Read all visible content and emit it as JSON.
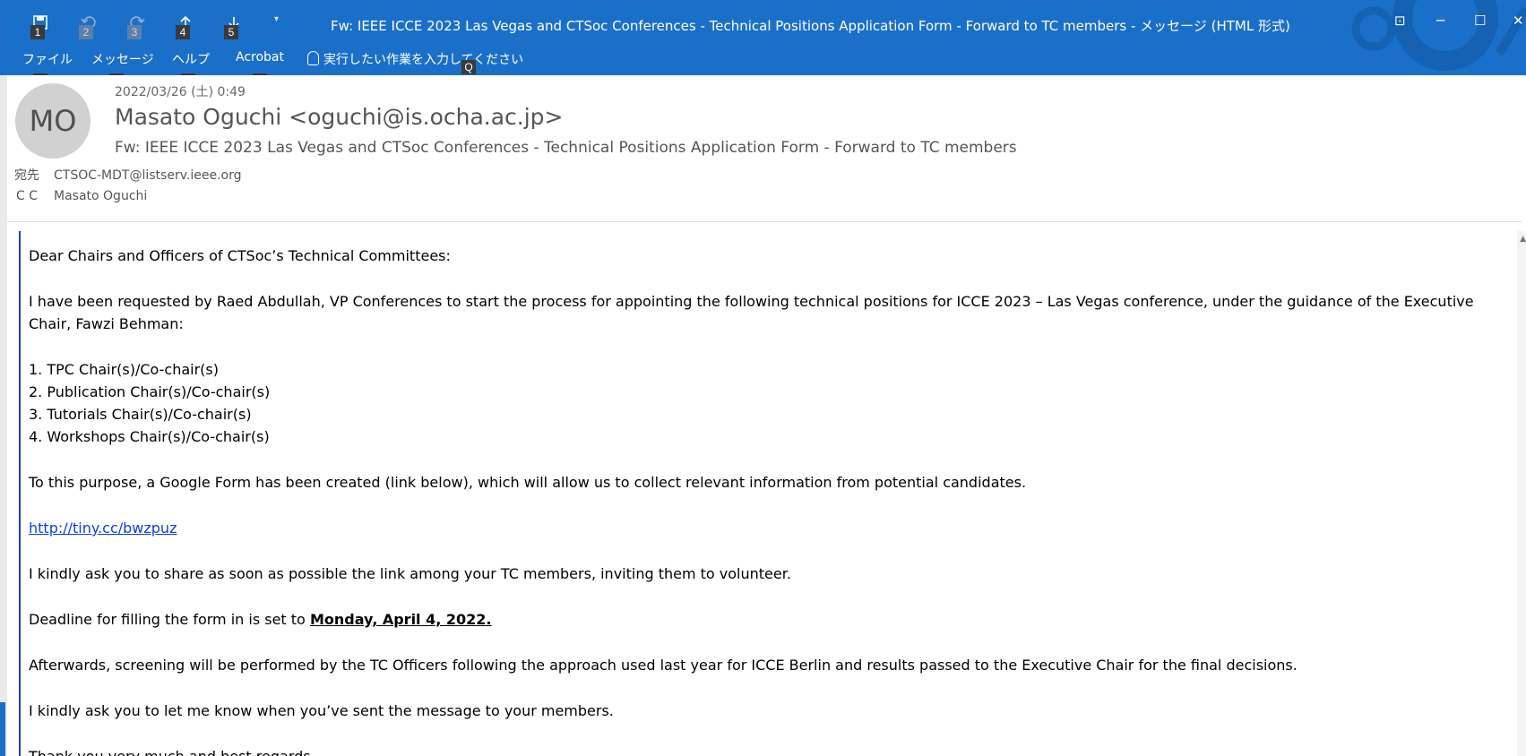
{
  "window": {
    "title": "Fw: IEEE ICCE 2023 Las Vegas and CTSoc Conferences - Technical Positions Application Form - Forward to TC members  -  メッセージ (HTML 形式)",
    "controls": [
      "⊡",
      "─",
      "☐",
      "✕"
    ]
  },
  "qat": [
    {
      "icon": "save-icon",
      "key": "1",
      "dim": false
    },
    {
      "icon": "undo-icon",
      "key": "2",
      "dim": true
    },
    {
      "icon": "redo-icon",
      "key": "3",
      "dim": true
    },
    {
      "icon": "up-icon",
      "key": "4",
      "dim": false
    },
    {
      "icon": "down-icon",
      "key": "5",
      "dim": false
    }
  ],
  "qat_more": "▾",
  "ribbon": {
    "tabs": [
      {
        "label": "ファイル",
        "key": "F"
      },
      {
        "label": "メッセージ",
        "key": "H"
      },
      {
        "label": "ヘルプ",
        "key": "E"
      },
      {
        "label": "Acrobat",
        "key": "B"
      }
    ],
    "search_placeholder": "実行したい作業を入力してください",
    "search_key": "Q"
  },
  "message": {
    "avatar_initials": "MO",
    "datetime": "2022/03/26 (土) 0:49",
    "sender": "Masato Oguchi <oguchi@is.ocha.ac.jp>",
    "subject": "Fw: IEEE ICCE 2023 Las Vegas and CTSoc Conferences - Technical Positions Application Form - Forward to TC members",
    "to_label": "宛先",
    "to_value": "CTSOC-MDT@listserv.ieee.org",
    "cc_label": "C C",
    "cc_value": "Masato Oguchi"
  },
  "body": {
    "greeting": "Dear Chairs and Officers of CTSoc’s Technical Committees:",
    "para1": "I have been requested by Raed Abdullah, VP Conferences to start the process for appointing the following technical positions for ICCE 2023 – Las Vegas conference, under the guidance of the Executive Chair, Fawzi Behman:",
    "list": [
      "1. TPC Chair(s)/Co-chair(s)",
      "2. Publication Chair(s)/Co-chair(s)",
      "3. Tutorials Chair(s)/Co-chair(s)",
      "4. Workshops Chair(s)/Co-chair(s)"
    ],
    "para2": "To this purpose, a Google Form has been created (link below), which will allow us to collect relevant information from potential candidates.",
    "link": "http://tiny.cc/bwzpuz",
    "para3": "I kindly ask you to share as soon as possible the link among your TC members, inviting them to volunteer.",
    "deadline_prefix": "Deadline for filling the form in is set to ",
    "deadline_date": "Monday, April 4, 2022.",
    "para4": "Afterwards, screening will be performed by the TC Officers following the approach used last year for ICCE Berlin and results passed to the Executive Chair for the final decisions.",
    "para5": "I kindly ask you to let me know when you’ve sent the message to your members.",
    "para6": "Thank you very much and best regards,"
  },
  "colors": {
    "titlebar": "#1a6fc9",
    "link": "#0b3ee8",
    "quote_bar": "#1a3fc4"
  }
}
